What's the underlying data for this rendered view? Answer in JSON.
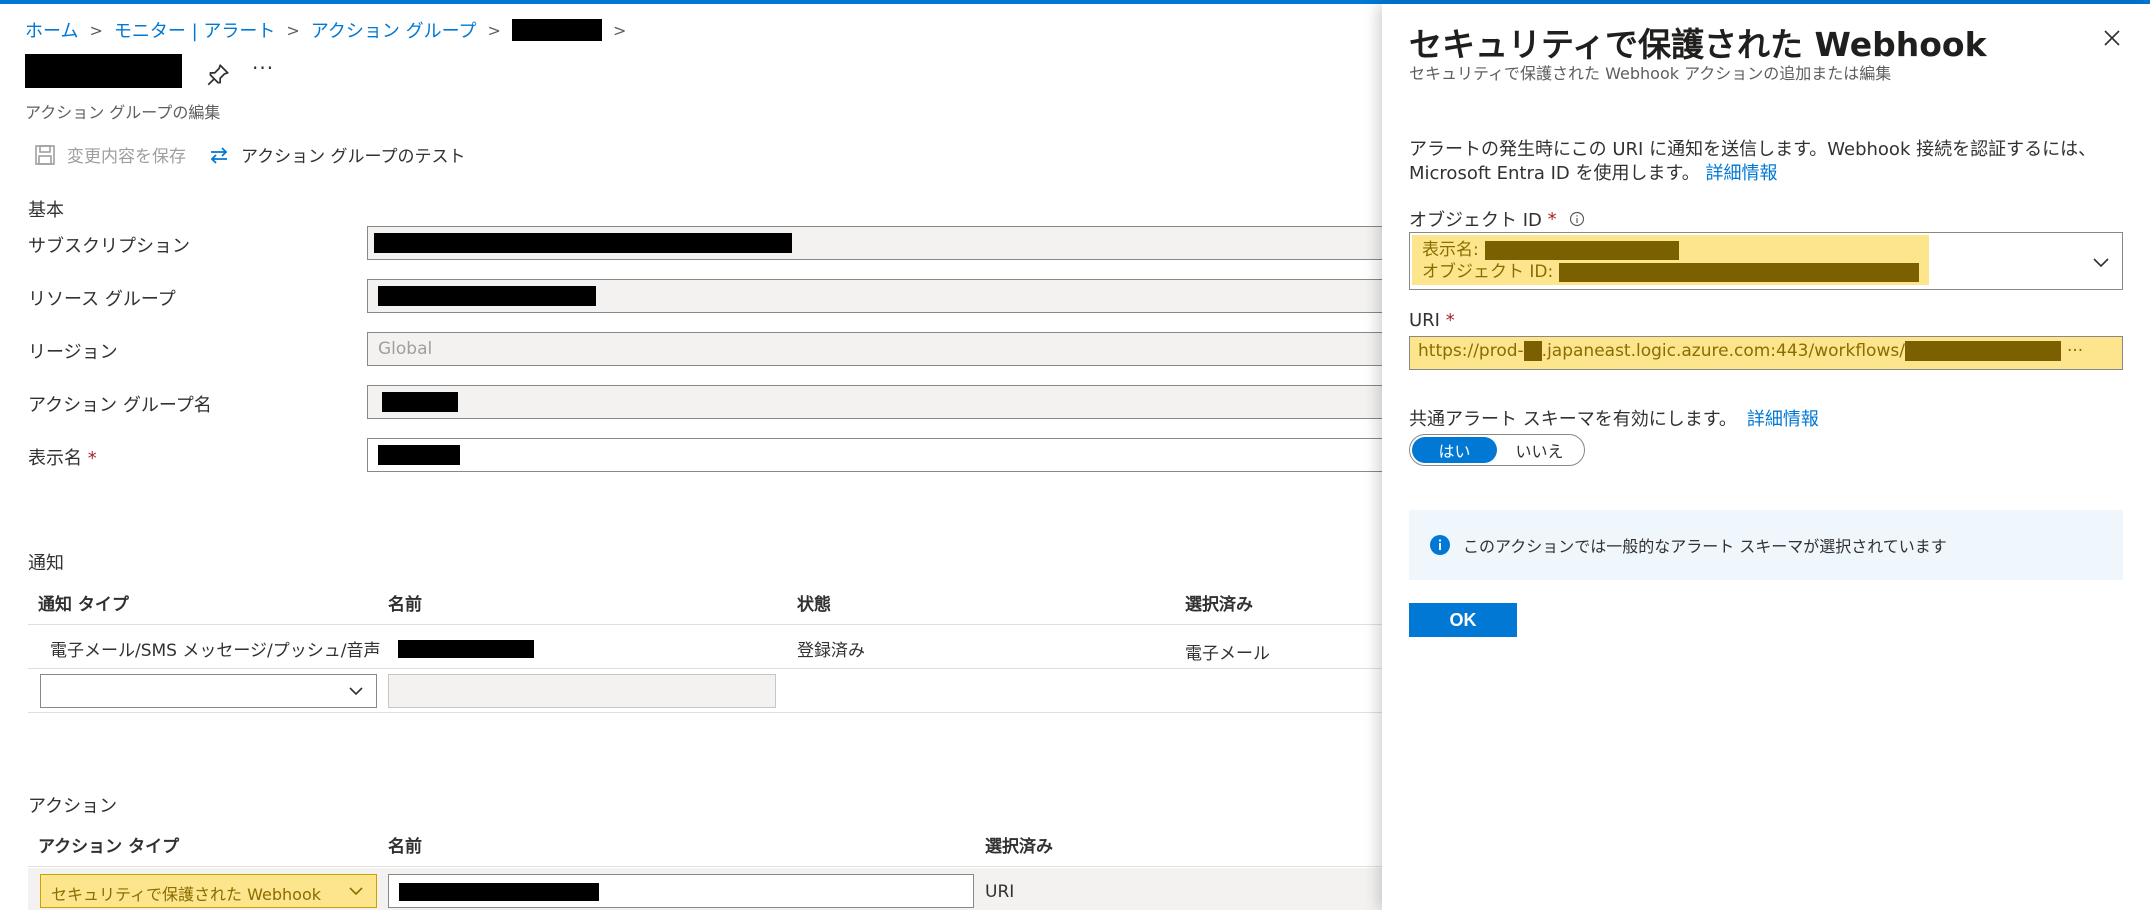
{
  "breadcrumb": {
    "items": [
      "ホーム",
      "モニター | アラート",
      "アクション グループ"
    ]
  },
  "page": {
    "subtitle": "アクション グループの編集"
  },
  "commands": {
    "save": "変更内容を保存",
    "test": "アクション グループのテスト"
  },
  "basics": {
    "heading": "基本",
    "subscription_label": "サブスクリプション",
    "resource_group_label": "リソース グループ",
    "region_label": "リージョン",
    "region_value": "Global",
    "action_group_name_label": "アクション グループ名",
    "display_name_label": "表示名",
    "required_mark": "*"
  },
  "notifications": {
    "heading": "通知",
    "columns": [
      "通知 タイプ",
      "名前",
      "状態",
      "選択済み"
    ],
    "rows": [
      {
        "type": "電子メール/SMS メッセージ/プッシュ/音声",
        "status": "登録済み",
        "selected": "電子メール"
      }
    ]
  },
  "actions": {
    "heading": "アクション",
    "columns": [
      "アクション タイプ",
      "名前",
      "選択済み"
    ],
    "rows": [
      {
        "type": "セキュリティで保護された Webhook",
        "selected": "URI"
      }
    ]
  },
  "panel": {
    "title": "セキュリティで保護された Webhook",
    "subtitle": "セキュリティで保護された Webhook アクションの追加または編集",
    "description": "アラートの発生時にこの URI に通知を送信します。Webhook 接続を認証するには、Microsoft Entra ID を使用します。",
    "learn_more": "詳細情報",
    "object_id_label": "オブジェクト ID",
    "required_mark": "*",
    "display_name_prefix": "表示名:",
    "object_id_prefix": "オブジェクト ID:",
    "uri_label": "URI",
    "uri_prefix": "https://prod-",
    "uri_middle": ".japaneast.logic.azure.com:443/workflows/",
    "uri_ellipsis": "···",
    "common_schema_label": "共通アラート スキーマを有効にします。",
    "common_schema_learn_more": "詳細情報",
    "toggle_yes": "はい",
    "toggle_no": "いいえ",
    "toggle_value": "はい",
    "info_message": "このアクションでは一般的なアラート スキーマが選択されています",
    "ok_label": "OK"
  },
  "colors": {
    "accent": "#0078d4",
    "highlight": "#fde58e"
  }
}
